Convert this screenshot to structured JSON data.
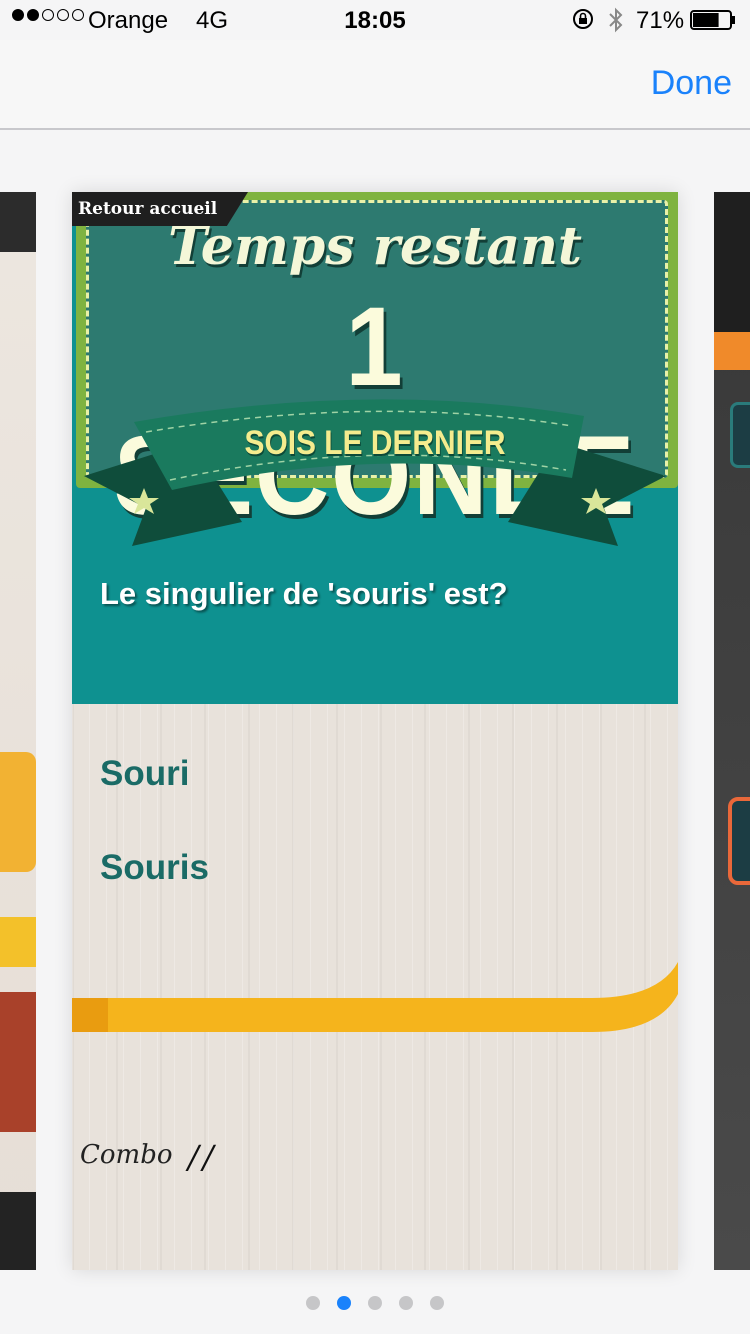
{
  "status_bar": {
    "signal_bars_filled": 2,
    "signal_bars_total": 5,
    "carrier": "Orange",
    "network": "4G",
    "time": "18:05",
    "icons": [
      "rotation-lock-icon",
      "bluetooth-icon",
      "battery-icon"
    ],
    "battery_percent": "71%",
    "battery_level": 0.71
  },
  "nav_bar": {
    "done_label": "Done",
    "accent_color": "#1a82fb"
  },
  "card": {
    "back_label": "Retour accueil",
    "timer_label": "Temps restant",
    "timer_value": "1 SECONDE",
    "banner_text": "SOIS LE DERNIER",
    "question": "Le singulier de 'souris' est?",
    "answers": [
      "Souri",
      "Souris"
    ],
    "combo_label": "Combo",
    "combo_value": "//",
    "colors": {
      "teal": "#0e9190",
      "board_green": "#2d7a70",
      "frame_green": "#7fb340",
      "answer_text": "#1a6b66",
      "progress_yellow": "#f5b41c"
    }
  },
  "pager": {
    "page_count": 5,
    "current_page": 2
  }
}
